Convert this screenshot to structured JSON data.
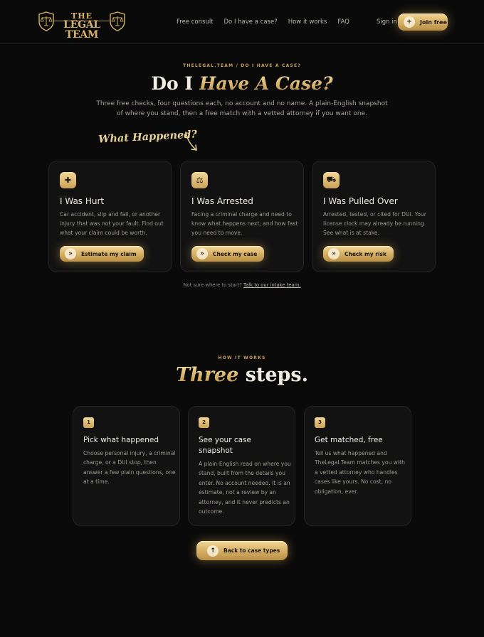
{
  "nav": {
    "logo_line1": "THE",
    "logo_line2": "LEGAL TEAM",
    "links": [
      "Free consult",
      "Do I have a case?",
      "How it works",
      "FAQ"
    ],
    "sign_in": "Sign in",
    "join_label": "Join free",
    "join_icon": "+"
  },
  "hero": {
    "breadcrumb": "THELEGAL.TEAM / DO I HAVE A CASE?",
    "title_plain": "Do I",
    "title_italic": "Have A Case?",
    "subtitle": "Three free checks, four questions each, no account and no name. A plain-English snapshot of where you stand, then a free match with a vetted attorney if you want one.",
    "script_label": "What Happened?"
  },
  "cases": [
    {
      "icon": "medical-cross-icon",
      "glyph": "✚",
      "title": "I Was Hurt",
      "desc": "Car accident, slip and fall, or another injury that was not your fault. Find out what your claim could be worth.",
      "button": "Estimate my claim"
    },
    {
      "icon": "gavel-icon",
      "glyph": "⚖",
      "title": "I Was Arrested",
      "desc": "Facing a criminal charge and need to know what happens next, and how fast you need to move.",
      "button": "Check my case"
    },
    {
      "icon": "car-icon",
      "glyph": "⛟",
      "title": "I Was Pulled Over",
      "desc": "Arrested, tested, or cited for DUI. Your license clock may already be running. See what is at stake.",
      "button": "Check my risk"
    }
  ],
  "help": {
    "text": "Not sure where to start?",
    "link": "Talk to our intake team."
  },
  "how": {
    "label": "HOW IT WORKS",
    "title_italic": "Three",
    "title_plain": "steps.",
    "steps": [
      {
        "num": "1",
        "title": "Pick what happened",
        "desc": "Choose personal injury, a criminal charge, or a DUI stop, then answer a few plain questions, one at a time."
      },
      {
        "num": "2",
        "title": "See your case snapshot",
        "desc": "A plain-English read on where you stand, built from the details you enter. No account needed. It is an estimate, not a review by an attorney, and it never predicts an outcome."
      },
      {
        "num": "3",
        "title": "Get matched, free",
        "desc": "Tell us what happened and TheLegal.Team matches you with a vetted attorney who handles cases like yours. No cost, no obligation, ever."
      }
    ],
    "back_button": "Back to case types",
    "back_icon": "↑"
  },
  "colors": {
    "accent_gold": "#d9b46a",
    "background": "#0a0a0a",
    "card": "#121212"
  }
}
